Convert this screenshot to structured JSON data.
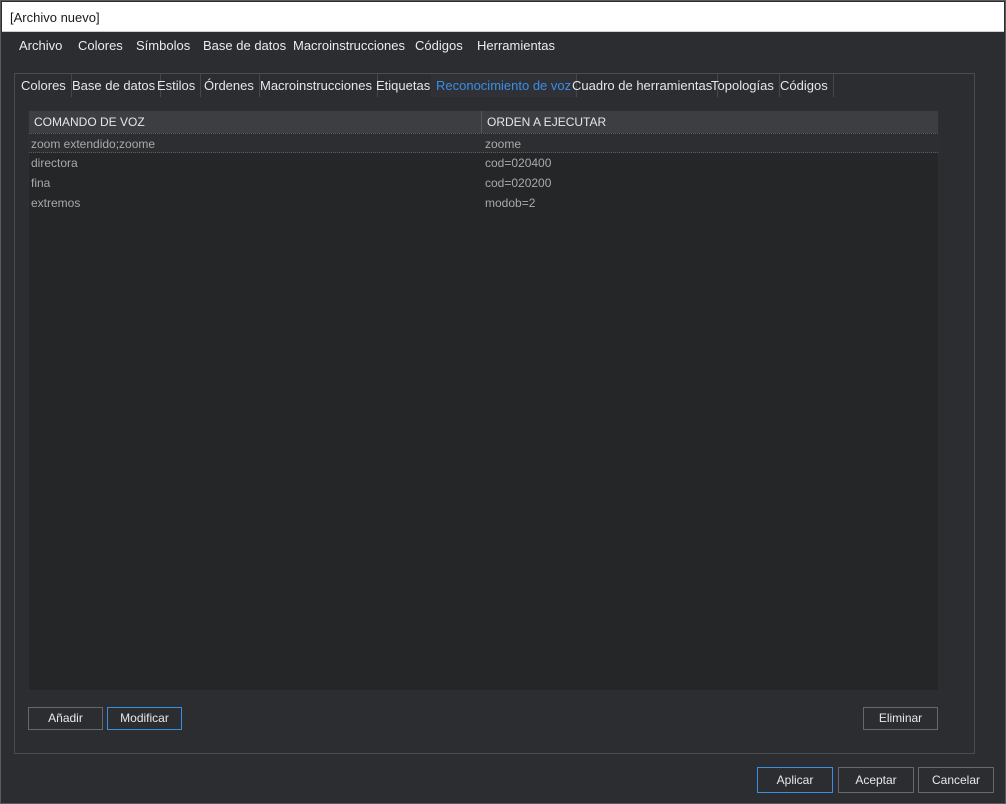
{
  "window": {
    "title": "[Archivo nuevo]"
  },
  "menu": [
    "Archivo",
    "Colores",
    "Símbolos",
    "Base de datos",
    "Macroinstrucciones",
    "Códigos",
    "Herramientas"
  ],
  "tabs": [
    {
      "label": "Colores",
      "active": false
    },
    {
      "label": "Base de datos",
      "active": false
    },
    {
      "label": "Estilos",
      "active": false
    },
    {
      "label": "Órdenes",
      "active": false
    },
    {
      "label": "Macroinstrucciones",
      "active": false
    },
    {
      "label": "Etiquetas",
      "active": false
    },
    {
      "label": "Reconocimiento de voz",
      "active": true
    },
    {
      "label": "Cuadro de herramientas",
      "active": false
    },
    {
      "label": "Topologías",
      "active": false
    },
    {
      "label": "Códigos",
      "active": false
    }
  ],
  "table": {
    "columns": [
      "COMANDO DE VOZ",
      "ORDEN A EJECUTAR"
    ],
    "rows": [
      [
        "zoom extendido;zoome",
        "zoome"
      ],
      [
        "directora",
        "cod=020400"
      ],
      [
        "fina",
        "cod=020200"
      ],
      [
        "extremos",
        "modob=2"
      ]
    ],
    "selected_row": 0
  },
  "panel_buttons": {
    "add": "Añadir",
    "modify": "Modificar",
    "delete": "Eliminar"
  },
  "dialog_buttons": {
    "apply": "Aplicar",
    "accept": "Aceptar",
    "cancel": "Cancelar"
  },
  "colors": {
    "accent": "#3a8ee6",
    "background": "#2b2d31"
  }
}
